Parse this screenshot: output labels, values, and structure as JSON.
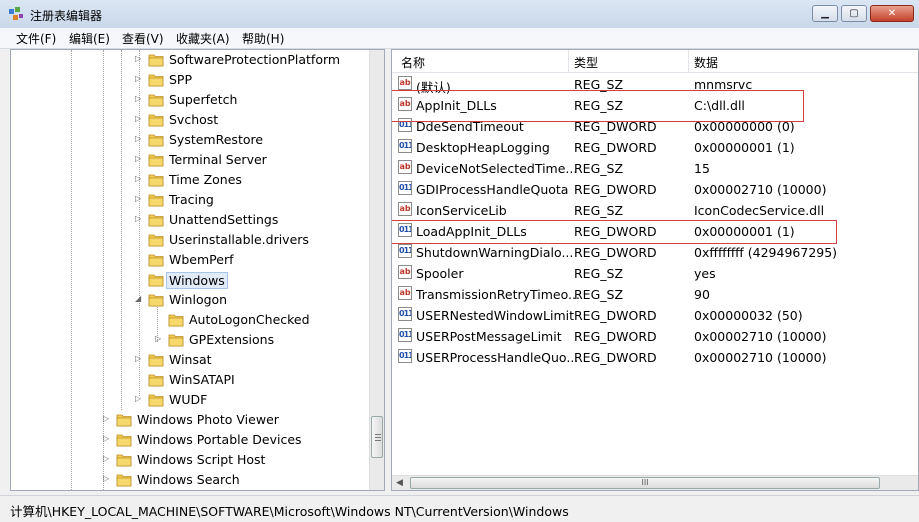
{
  "window": {
    "title": "注册表编辑器",
    "minimize_glyph": "▁",
    "maximize_glyph": "▢",
    "close_glyph": "✕"
  },
  "menu": [
    "文件(F)",
    "编辑(E)",
    "查看(V)",
    "收藏夹(A)",
    "帮助(H)"
  ],
  "tree": {
    "items": [
      {
        "label": "SoftwareProtectionPlatform",
        "level": 3,
        "expander": "collapsed"
      },
      {
        "label": "SPP",
        "level": 3,
        "expander": "collapsed"
      },
      {
        "label": "Superfetch",
        "level": 3,
        "expander": "collapsed"
      },
      {
        "label": "Svchost",
        "level": 3,
        "expander": "collapsed"
      },
      {
        "label": "SystemRestore",
        "level": 3,
        "expander": "collapsed"
      },
      {
        "label": "Terminal Server",
        "level": 3,
        "expander": "collapsed"
      },
      {
        "label": "Time Zones",
        "level": 3,
        "expander": "collapsed"
      },
      {
        "label": "Tracing",
        "level": 3,
        "expander": "collapsed"
      },
      {
        "label": "UnattendSettings",
        "level": 3,
        "expander": "collapsed"
      },
      {
        "label": "Userinstallable.drivers",
        "level": 3,
        "expander": "none"
      },
      {
        "label": "WbemPerf",
        "level": 3,
        "expander": "none"
      },
      {
        "label": "Windows",
        "level": 3,
        "expander": "none",
        "selected": true
      },
      {
        "label": "Winlogon",
        "level": 3,
        "expander": "expanded"
      },
      {
        "label": "AutoLogonChecked",
        "level": 4,
        "expander": "none"
      },
      {
        "label": "GPExtensions",
        "level": 4,
        "expander": "collapsed"
      },
      {
        "label": "Winsat",
        "level": 3,
        "expander": "collapsed"
      },
      {
        "label": "WinSATAPI",
        "level": 3,
        "expander": "none"
      },
      {
        "label": "WUDF",
        "level": 3,
        "expander": "collapsed"
      },
      {
        "label": "Windows Photo Viewer",
        "level": 1,
        "expander": "collapsed"
      },
      {
        "label": "Windows Portable Devices",
        "level": 1,
        "expander": "collapsed"
      },
      {
        "label": "Windows Script Host",
        "level": 1,
        "expander": "collapsed"
      },
      {
        "label": "Windows Search",
        "level": 1,
        "expander": "collapsed"
      }
    ]
  },
  "list": {
    "headers": {
      "name": "名称",
      "type": "类型",
      "data": "数据"
    },
    "rows": [
      {
        "icon": "sz",
        "name": "(默认)",
        "type": "REG_SZ",
        "data": "mnmsrvc"
      },
      {
        "icon": "sz",
        "name": "AppInit_DLLs",
        "type": "REG_SZ",
        "data": "C:\\dll.dll",
        "highlighted": true
      },
      {
        "icon": "dword",
        "name": "DdeSendTimeout",
        "type": "REG_DWORD",
        "data": "0x00000000 (0)"
      },
      {
        "icon": "dword",
        "name": "DesktopHeapLogging",
        "type": "REG_DWORD",
        "data": "0x00000001 (1)"
      },
      {
        "icon": "sz",
        "name": "DeviceNotSelectedTime...",
        "type": "REG_SZ",
        "data": "15"
      },
      {
        "icon": "dword",
        "name": "GDIProcessHandleQuota",
        "type": "REG_DWORD",
        "data": "0x00002710 (10000)"
      },
      {
        "icon": "sz",
        "name": "IconServiceLib",
        "type": "REG_SZ",
        "data": "IconCodecService.dll"
      },
      {
        "icon": "dword",
        "name": "LoadAppInit_DLLs",
        "type": "REG_DWORD",
        "data": "0x00000001 (1)",
        "highlighted": true
      },
      {
        "icon": "dword",
        "name": "ShutdownWarningDialo...",
        "type": "REG_DWORD",
        "data": "0xffffffff (4294967295)"
      },
      {
        "icon": "sz",
        "name": "Spooler",
        "type": "REG_SZ",
        "data": "yes"
      },
      {
        "icon": "sz",
        "name": "TransmissionRetryTimeo...",
        "type": "REG_SZ",
        "data": "90"
      },
      {
        "icon": "dword",
        "name": "USERNestedWindowLimit",
        "type": "REG_DWORD",
        "data": "0x00000032 (50)"
      },
      {
        "icon": "dword",
        "name": "USERPostMessageLimit",
        "type": "REG_DWORD",
        "data": "0x00002710 (10000)"
      },
      {
        "icon": "dword",
        "name": "USERProcessHandleQuo...",
        "type": "REG_DWORD",
        "data": "0x00002710 (10000)"
      }
    ],
    "icon_text": {
      "sz": "ab",
      "dword": "011"
    },
    "scroll_grip": "III"
  },
  "status": {
    "path": "计算机\\HKEY_LOCAL_MACHINE\\SOFTWARE\\Microsoft\\Windows NT\\CurrentVersion\\Windows"
  },
  "colors": {
    "highlight_border": "#d04040",
    "selection_bg": "#e1ebf7",
    "folder": "#f2c94c"
  }
}
